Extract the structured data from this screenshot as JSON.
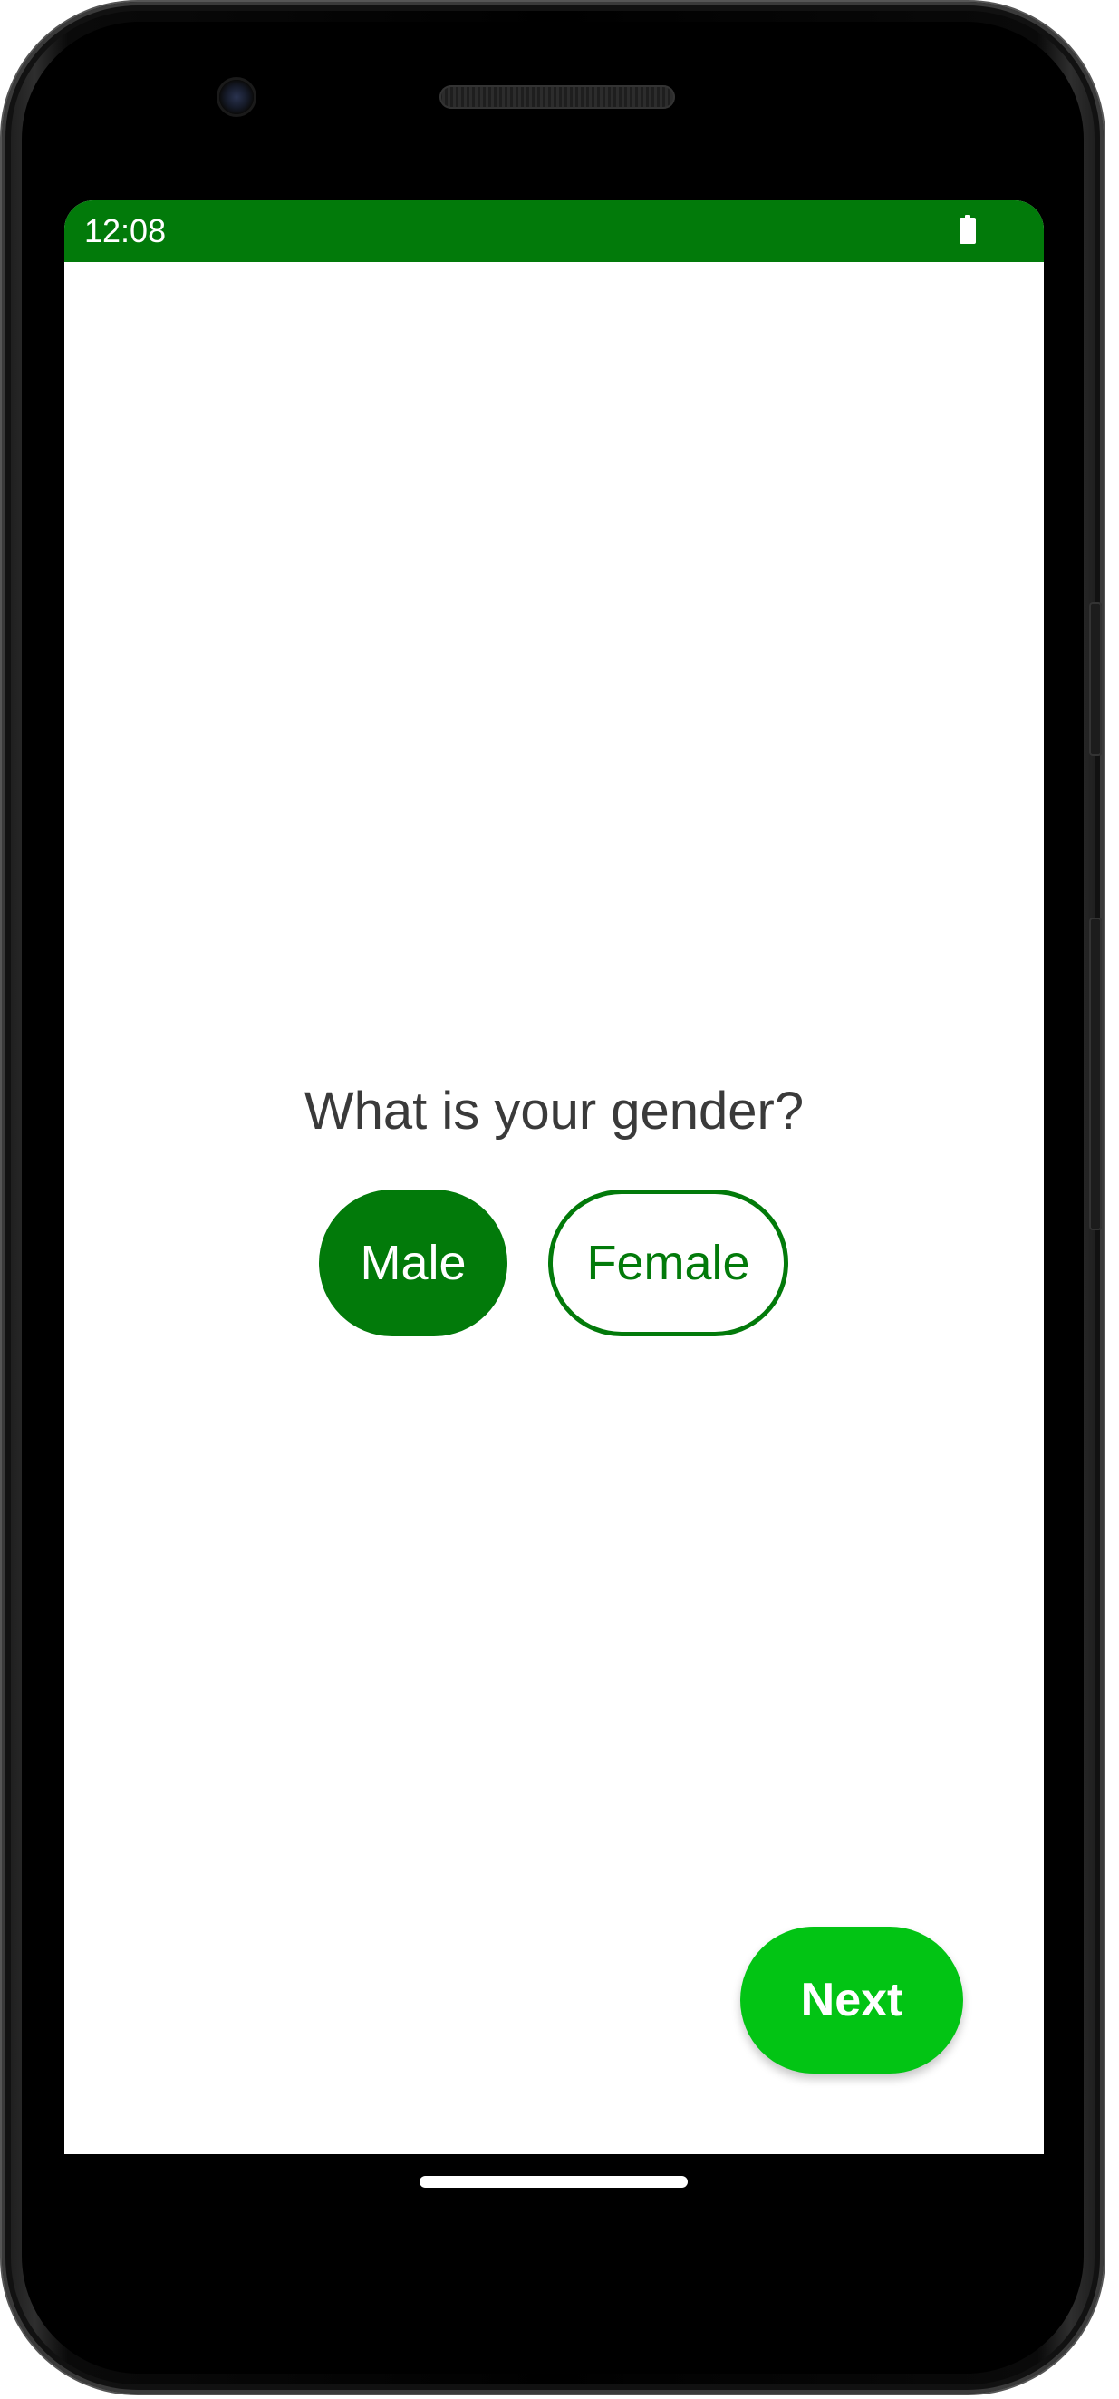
{
  "status_bar": {
    "time": "12:08",
    "icons": [
      "battery-icon"
    ],
    "color": "#027A0A"
  },
  "main": {
    "question": "What is your gender?",
    "options": [
      {
        "label": "Male",
        "selected": true
      },
      {
        "label": "Female",
        "selected": false
      }
    ],
    "next_label": "Next"
  },
  "colors": {
    "primary": "#027A0A",
    "next_button": "#02C414",
    "question_text": "#3a3a3a"
  }
}
